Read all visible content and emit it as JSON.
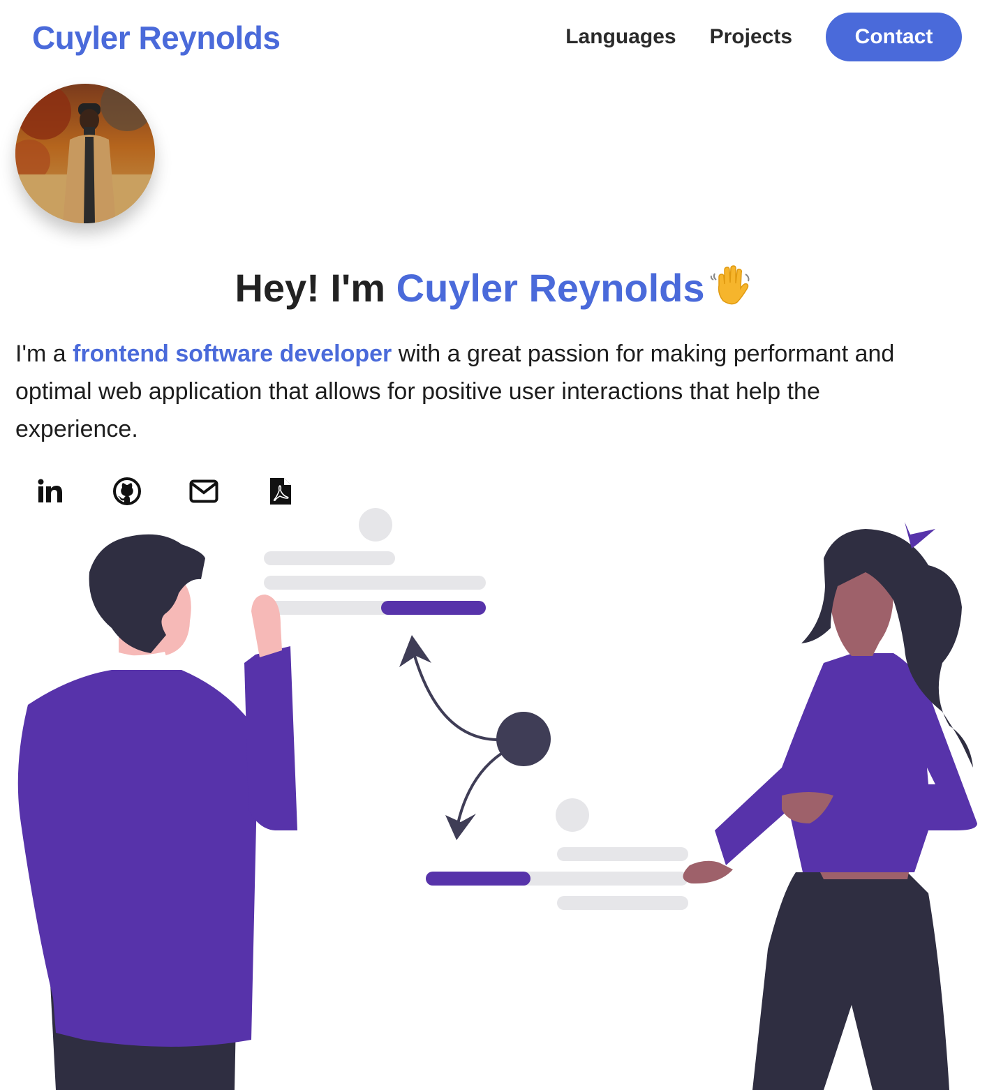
{
  "header": {
    "brand": "Cuyler Reynolds",
    "nav": {
      "languages": "Languages",
      "projects": "Projects",
      "contact": "Contact"
    }
  },
  "hero": {
    "title_prefix": "Hey! I'm ",
    "title_name": "Cuyler Reynolds",
    "intro_prefix": "I'm a ",
    "intro_highlight": "frontend software developer",
    "intro_rest": " with a great passion for making performant and optimal web application that allows for positive user interactions that help the experience."
  },
  "socials": [
    {
      "icon": "linkedin-icon"
    },
    {
      "icon": "github-icon"
    },
    {
      "icon": "mail-icon"
    },
    {
      "icon": "pdf-resume-icon"
    }
  ],
  "colors": {
    "accent": "#4a6ada",
    "purple": "#5733aa",
    "dark": "#2f2e41",
    "light_gray": "#e6e6e9"
  }
}
